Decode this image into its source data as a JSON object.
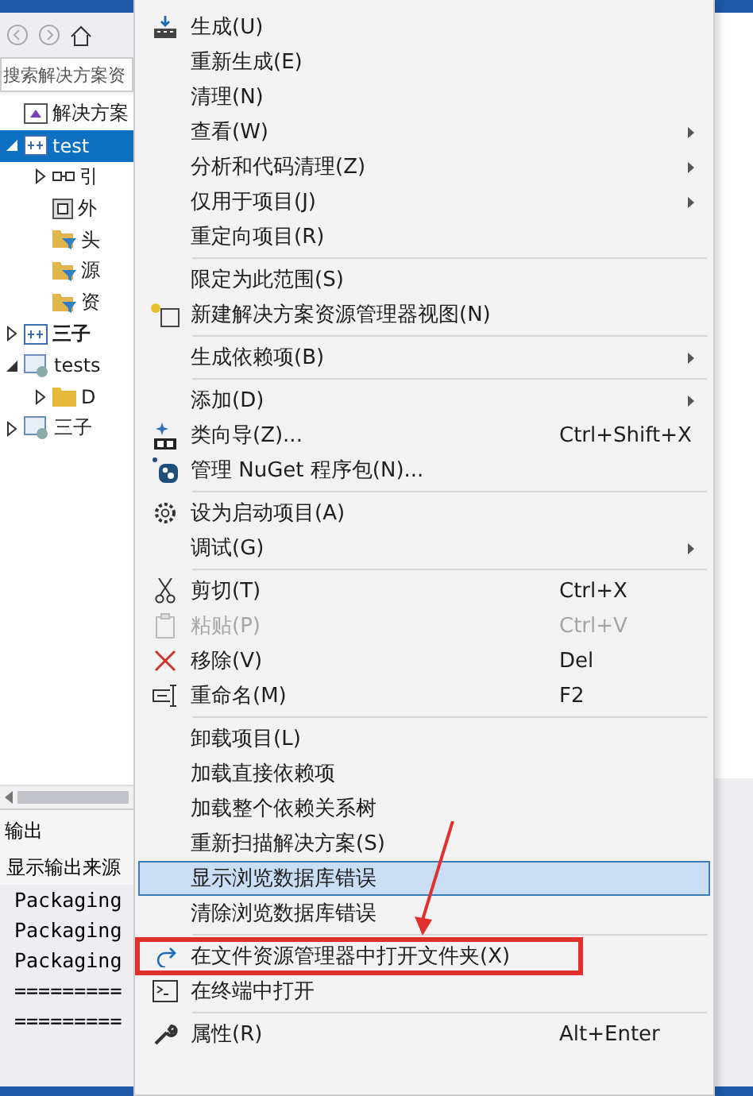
{
  "explorer": {
    "search": {
      "placeholder": "搜索解决方案资"
    },
    "tree": [
      {
        "label": "解决方案",
        "kind": "solution",
        "selected": false
      },
      {
        "label": "test",
        "kind": "project",
        "selected": true,
        "expanded": true,
        "children": [
          {
            "label": "引",
            "kind": "references",
            "selected": false,
            "expanded": false
          },
          {
            "label": "外",
            "kind": "external",
            "selected": false
          },
          {
            "label": "头",
            "kind": "filter",
            "selected": false
          },
          {
            "label": "源",
            "kind": "filter",
            "selected": false
          },
          {
            "label": "资",
            "kind": "filter",
            "selected": false
          }
        ]
      },
      {
        "label": "三子",
        "kind": "project",
        "selected": false,
        "bold": true,
        "expanded": false
      },
      {
        "label": "tests",
        "kind": "testproject",
        "selected": false,
        "expanded": true,
        "children": [
          {
            "label": "D",
            "kind": "folder",
            "selected": false,
            "expanded": false
          }
        ]
      },
      {
        "label": "三子",
        "kind": "testproject",
        "selected": false,
        "expanded": false
      }
    ]
  },
  "output": {
    "title": "输出",
    "source_label": "显示输出来源",
    "lines": [
      "Packaging",
      "Packaging",
      "Packaging",
      "=========",
      "========="
    ]
  },
  "menu": [
    {
      "kind": "build",
      "label": "生成(U)",
      "selected": false
    },
    {
      "kind": "item",
      "label": "重新生成(E)",
      "selected": false
    },
    {
      "kind": "item",
      "label": "清理(N)",
      "selected": false
    },
    {
      "kind": "item",
      "label": "查看(W)",
      "submenu": true,
      "selected": false
    },
    {
      "kind": "item",
      "label": "分析和代码清理(Z)",
      "submenu": true,
      "selected": false
    },
    {
      "kind": "item",
      "label": "仅用于项目(J)",
      "submenu": true,
      "selected": false
    },
    {
      "kind": "item",
      "label": "重定向项目(R)",
      "selected": false
    },
    {
      "kind": "separator"
    },
    {
      "kind": "item",
      "label": "限定为此范围(S)",
      "selected": false
    },
    {
      "kind": "newview",
      "label": "新建解决方案资源管理器视图(N)",
      "selected": false
    },
    {
      "kind": "separator"
    },
    {
      "kind": "item",
      "label": "生成依赖项(B)",
      "submenu": true,
      "selected": false
    },
    {
      "kind": "separator"
    },
    {
      "kind": "item",
      "label": "添加(D)",
      "submenu": true,
      "selected": false
    },
    {
      "kind": "wizard",
      "label": "类向导(Z)...",
      "shortcut": "Ctrl+Shift+X",
      "selected": false
    },
    {
      "kind": "nuget",
      "label": "管理 NuGet 程序包(N)...",
      "selected": false
    },
    {
      "kind": "separator"
    },
    {
      "kind": "gear",
      "label": "设为启动项目(A)",
      "selected": false
    },
    {
      "kind": "item",
      "label": "调试(G)",
      "submenu": true,
      "selected": false
    },
    {
      "kind": "separator"
    },
    {
      "kind": "scissors",
      "label": "剪切(T)",
      "shortcut": "Ctrl+X",
      "selected": false
    },
    {
      "kind": "clipboard",
      "label": "粘贴(P)",
      "shortcut": "Ctrl+V",
      "disabled": true,
      "selected": false
    },
    {
      "kind": "cross",
      "label": "移除(V)",
      "shortcut": "Del",
      "selected": false
    },
    {
      "kind": "rename",
      "label": "重命名(M)",
      "shortcut": "F2",
      "selected": false
    },
    {
      "kind": "separator"
    },
    {
      "kind": "item",
      "label": "卸载项目(L)",
      "selected": false
    },
    {
      "kind": "item",
      "label": "加载直接依赖项",
      "selected": false
    },
    {
      "kind": "item",
      "label": "加载整个依赖关系树",
      "selected": false
    },
    {
      "kind": "item",
      "label": "重新扫描解决方案(S)",
      "selected": false
    },
    {
      "kind": "item",
      "label": "显示浏览数据库错误",
      "selected": true
    },
    {
      "kind": "item",
      "label": "清除浏览数据库错误",
      "selected": false
    },
    {
      "kind": "separator"
    },
    {
      "kind": "redo",
      "label": "在文件资源管理器中打开文件夹(X)",
      "annotated": true,
      "selected": false
    },
    {
      "kind": "terminal",
      "label": "在终端中打开",
      "selected": false
    },
    {
      "kind": "separator"
    },
    {
      "kind": "wrench",
      "label": "属性(R)",
      "shortcut": "Alt+Enter",
      "selected": false
    }
  ]
}
